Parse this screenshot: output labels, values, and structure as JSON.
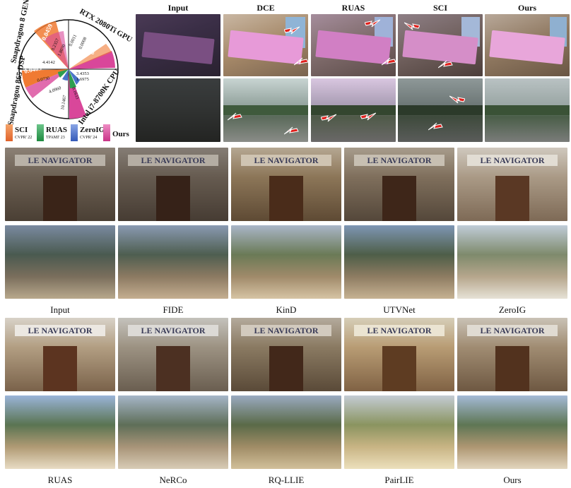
{
  "figure": {
    "radial": {
      "devices": [
        "Snapdragon 8 GEN 3 NPU",
        "RTX 2080Ti GPU",
        "Intel i7-8700K CPU",
        "Snapdragon 865 DSP"
      ],
      "values": {
        "npu": [
          "0.0459",
          "0.2357",
          "1.8030"
        ],
        "gpu": [
          "0.0011",
          "0.0008",
          "0.0002"
        ],
        "cpu": [
          "3.4353",
          "1.6975",
          "0.1633",
          "0.0109"
        ],
        "dsp": [
          "0.0403",
          "0.0730",
          "4.4142",
          "4.0960",
          "10.1467"
        ]
      },
      "colors": {
        "sci": "#f07a32",
        "ruas": "#2e9e4f",
        "zeroig": "#4a73c9",
        "ours": "#d9479a"
      }
    },
    "legend": [
      {
        "name": "SCI",
        "venue": "CVPR' 22",
        "color": "#f07a32"
      },
      {
        "name": "RUAS",
        "venue": "TPAMI' 23",
        "color": "#2e9e4f"
      },
      {
        "name": "ZeroIG",
        "venue": "CVPR' 24",
        "color": "#4a73c9"
      },
      {
        "name": "Ours",
        "venue": "",
        "color": "#d9479a"
      }
    ],
    "top_headers": [
      "Input",
      "DCE",
      "RUAS",
      "SCI",
      "Ours"
    ],
    "mid_labels": [
      "Input",
      "FIDE",
      "KinD",
      "UTVNet",
      "ZeroIG"
    ],
    "bottom_labels": [
      "RUAS",
      "NeRCo",
      "RQ-LLIE",
      "PairLIE",
      "Ours"
    ],
    "sign_text": "LE NAVIGATOR"
  }
}
